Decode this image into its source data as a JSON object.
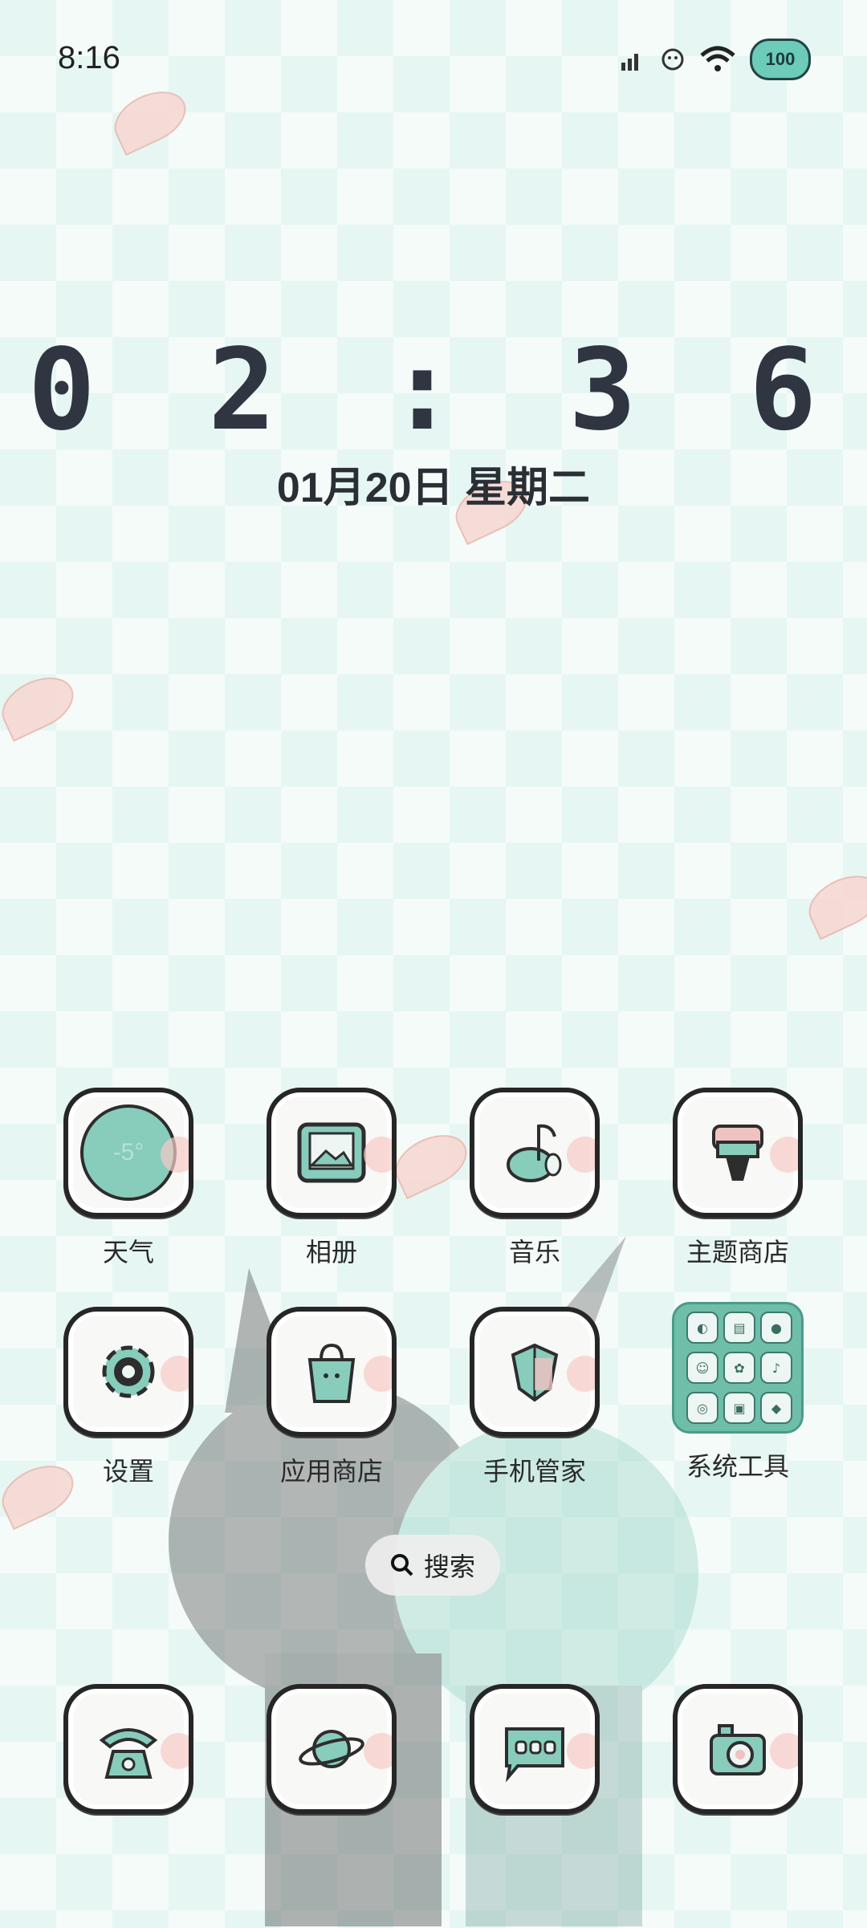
{
  "status_bar": {
    "time": "8:16",
    "battery": "100",
    "icons": [
      "signal-icon",
      "face-icon",
      "wifi-icon",
      "battery-icon"
    ]
  },
  "clock": {
    "time": "0 2 : 3 6",
    "date": "01月20日 星期二"
  },
  "apps": [
    {
      "label": "天气",
      "icon": "weather-icon"
    },
    {
      "label": "相册",
      "icon": "gallery-icon"
    },
    {
      "label": "音乐",
      "icon": "music-icon"
    },
    {
      "label": "主题商店",
      "icon": "theme-store-icon"
    },
    {
      "label": "设置",
      "icon": "settings-icon"
    },
    {
      "label": "应用商店",
      "icon": "app-store-icon"
    },
    {
      "label": "手机管家",
      "icon": "phone-manager-icon"
    },
    {
      "label": "系统工具",
      "icon": "folder-icon"
    }
  ],
  "weather_temp": "-5°",
  "search": {
    "label": "搜索"
  },
  "dock": [
    {
      "icon": "phone-icon"
    },
    {
      "icon": "browser-icon"
    },
    {
      "icon": "messages-icon"
    },
    {
      "icon": "camera-icon"
    }
  ],
  "colors": {
    "accent": "#6ccbb9",
    "background": "#e6f6f3",
    "text": "#2f3541"
  }
}
